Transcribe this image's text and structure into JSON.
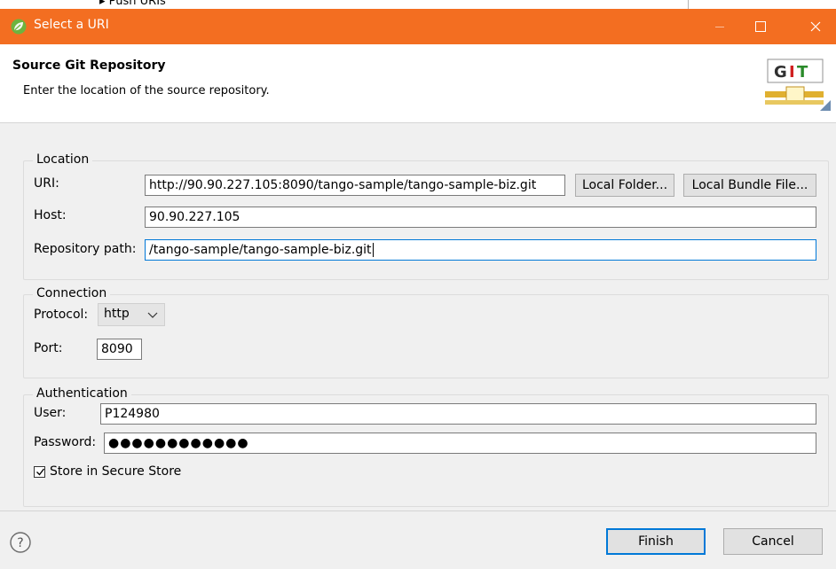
{
  "background": {
    "tree_item": "Push URIs"
  },
  "window": {
    "title": "Select a URI",
    "title_bar_color": "#f36e21"
  },
  "header": {
    "title": "Source Git Repository",
    "description": "Enter the location of the source repository.",
    "icon_text": "GIT"
  },
  "location": {
    "legend": "Location",
    "uri_label": "URI:",
    "uri_value": "http://90.90.227.105:8090/tango-sample/tango-sample-biz.git",
    "local_folder_button": "Local Folder...",
    "local_bundle_button": "Local Bundle File...",
    "host_label": "Host:",
    "host_value": "90.90.227.105",
    "repo_path_label": "Repository path:",
    "repo_path_value": "/tango-sample/tango-sample-biz.git"
  },
  "connection": {
    "legend": "Connection",
    "protocol_label": "Protocol:",
    "protocol_value": "http",
    "port_label": "Port:",
    "port_value": "8090"
  },
  "authentication": {
    "legend": "Authentication",
    "user_label": "User:",
    "user_value": "P124980",
    "password_label": "Password:",
    "password_value": "●●●●●●●●●●●●",
    "store_label": "Store in Secure Store",
    "store_checked": true
  },
  "footer": {
    "finish_button": "Finish",
    "cancel_button": "Cancel"
  },
  "icons": [
    "spring-leaf-icon",
    "git-icon",
    "help-icon",
    "chevron-down-icon",
    "checkmark-icon",
    "close-icon"
  ]
}
